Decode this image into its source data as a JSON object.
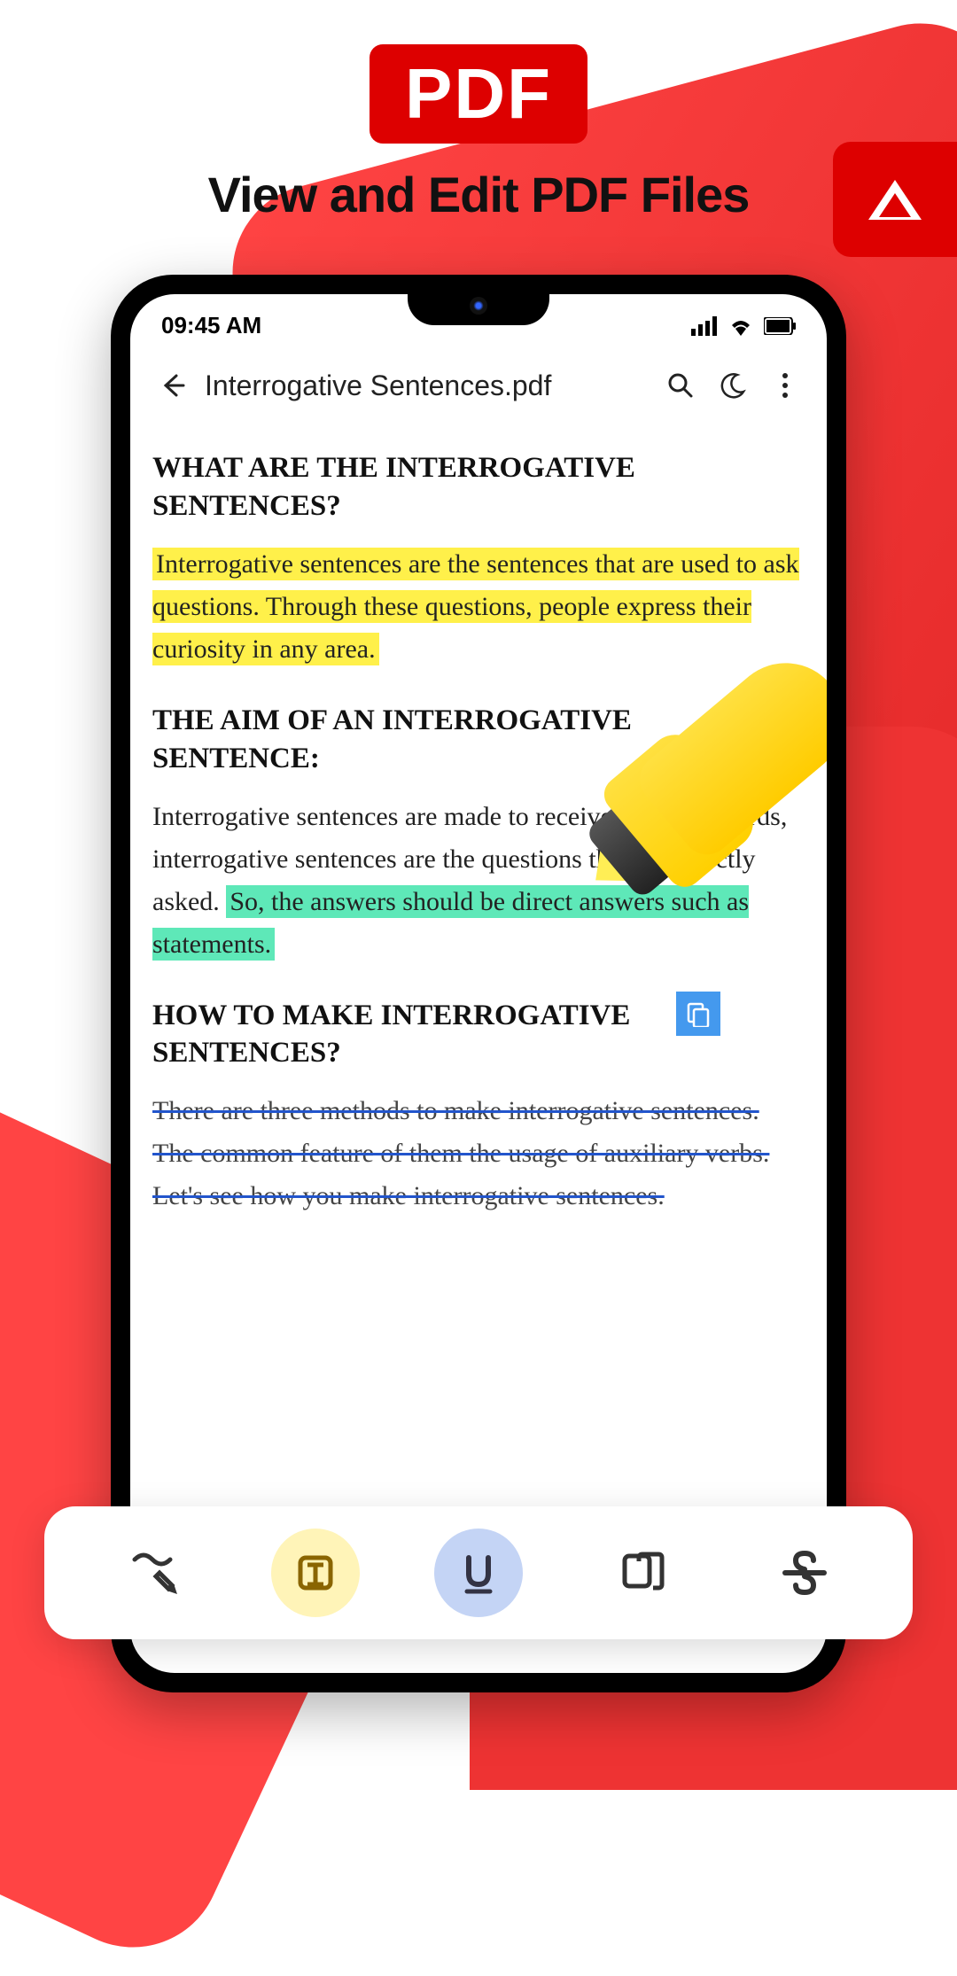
{
  "header": {
    "badge": "PDF",
    "tagline": "View and Edit PDF Files"
  },
  "statusBar": {
    "time": "09:45 AM"
  },
  "appBar": {
    "title": "Interrogative Sentences.pdf"
  },
  "document": {
    "section1": {
      "heading": "WHAT ARE THE INTERROGATIVE SENTENCES?",
      "text": "Interrogative sentences are the sentences that are used to ask questions. Through these questions, people express their curiosity in any area."
    },
    "section2": {
      "heading": "THE AIM OF AN INTERROGATIVE SENTENCE:",
      "textBefore": "Interrogative sentences are made to receive. In other words, interrogative sentences are the questions that are directly asked. ",
      "textHighlight": "So, the answers should be direct answers such as statements."
    },
    "section3": {
      "heading": "HOW TO MAKE INTERROGATIVE SENTENCES?",
      "text": "There are three methods to make interrogative sentences. The common feature of them the usage of auxiliary verbs. Let's see how you make interrogative sentences."
    }
  },
  "toolbar": {
    "tools": [
      "draw",
      "highlight",
      "underline",
      "copy",
      "strikethrough"
    ]
  }
}
